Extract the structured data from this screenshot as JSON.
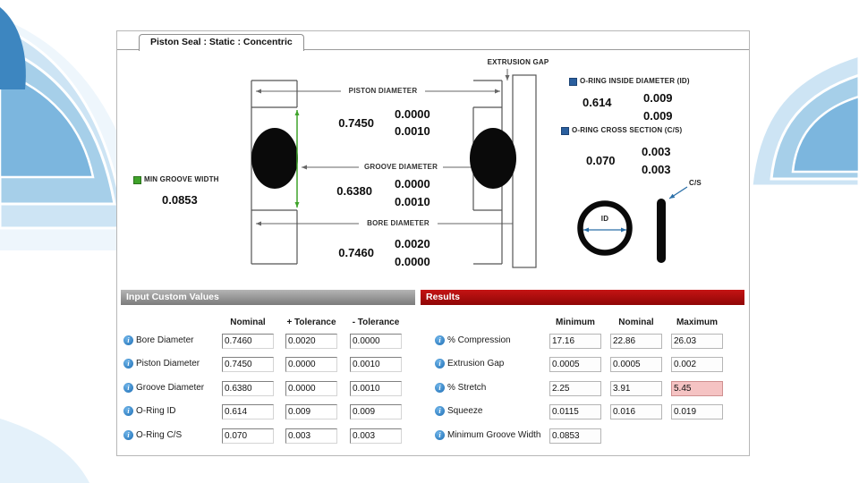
{
  "window": {
    "tab_title": "Piston Seal : Static : Concentric"
  },
  "diagram": {
    "extrusion_gap_label": "EXTRUSION GAP",
    "piston_diameter": {
      "label": "PISTON DIAMETER",
      "nominal": "0.7450",
      "plus_tolerance": "0.0000",
      "minus_tolerance": "0.0010"
    },
    "groove_diameter": {
      "label": "GROOVE DIAMETER",
      "nominal": "0.6380",
      "plus_tolerance": "0.0000",
      "minus_tolerance": "0.0010"
    },
    "bore_diameter": {
      "label": "BORE DIAMETER",
      "nominal": "0.7460",
      "plus_tolerance": "0.0020",
      "minus_tolerance": "0.0000"
    },
    "min_groove_width": {
      "label": "MIN GROOVE WIDTH",
      "value": "0.0853"
    },
    "oring_id": {
      "label": "O-RING INSIDE DIAMETER (ID)",
      "nominal": "0.614",
      "plus_tolerance": "0.009",
      "minus_tolerance": "0.009"
    },
    "oring_cs": {
      "label": "O-RING CROSS SECTION (C/S)",
      "nominal": "0.070",
      "plus_tolerance": "0.003",
      "minus_tolerance": "0.003"
    },
    "id_label": "ID",
    "cs_label": "C/S"
  },
  "input_panel": {
    "title": "Input Custom Values",
    "columns": [
      "Nominal",
      "+ Tolerance",
      "- Tolerance"
    ],
    "rows": [
      {
        "label": "Bore Diameter",
        "nominal": "0.7460",
        "plus": "0.0020",
        "minus": "0.0000"
      },
      {
        "label": "Piston Diameter",
        "nominal": "0.7450",
        "plus": "0.0000",
        "minus": "0.0010"
      },
      {
        "label": "Groove Diameter",
        "nominal": "0.6380",
        "plus": "0.0000",
        "minus": "0.0010"
      },
      {
        "label": "O-Ring ID",
        "nominal": "0.614",
        "plus": "0.009",
        "minus": "0.009"
      },
      {
        "label": "O-Ring C/S",
        "nominal": "0.070",
        "plus": "0.003",
        "minus": "0.003"
      }
    ]
  },
  "results_panel": {
    "title": "Results",
    "columns": [
      "Minimum",
      "Nominal",
      "Maximum"
    ],
    "rows": [
      {
        "label": "% Compression",
        "minimum": "17.16",
        "nominal": "22.86",
        "maximum": "26.03"
      },
      {
        "label": "Extrusion Gap",
        "minimum": "0.0005",
        "nominal": "0.0005",
        "maximum": "0.002"
      },
      {
        "label": "% Stretch",
        "minimum": "2.25",
        "nominal": "3.91",
        "maximum": "5.45"
      },
      {
        "label": "Squeeze",
        "minimum": "0.0115",
        "nominal": "0.016",
        "maximum": "0.019"
      },
      {
        "label": "Minimum Groove Width",
        "minimum": "0.0853"
      }
    ]
  },
  "icons": {
    "info_icon": "i"
  },
  "colors": {
    "results_header": "#a50d0d",
    "input_header": "#8f8f8f",
    "stretch_max_highlight": "#f5c3c3",
    "legend_green": "#3fa32a",
    "legend_blue": "#2a5f9e",
    "callout_blue": "#2a6fa8",
    "swoosh_blue": "#7cb6de"
  }
}
